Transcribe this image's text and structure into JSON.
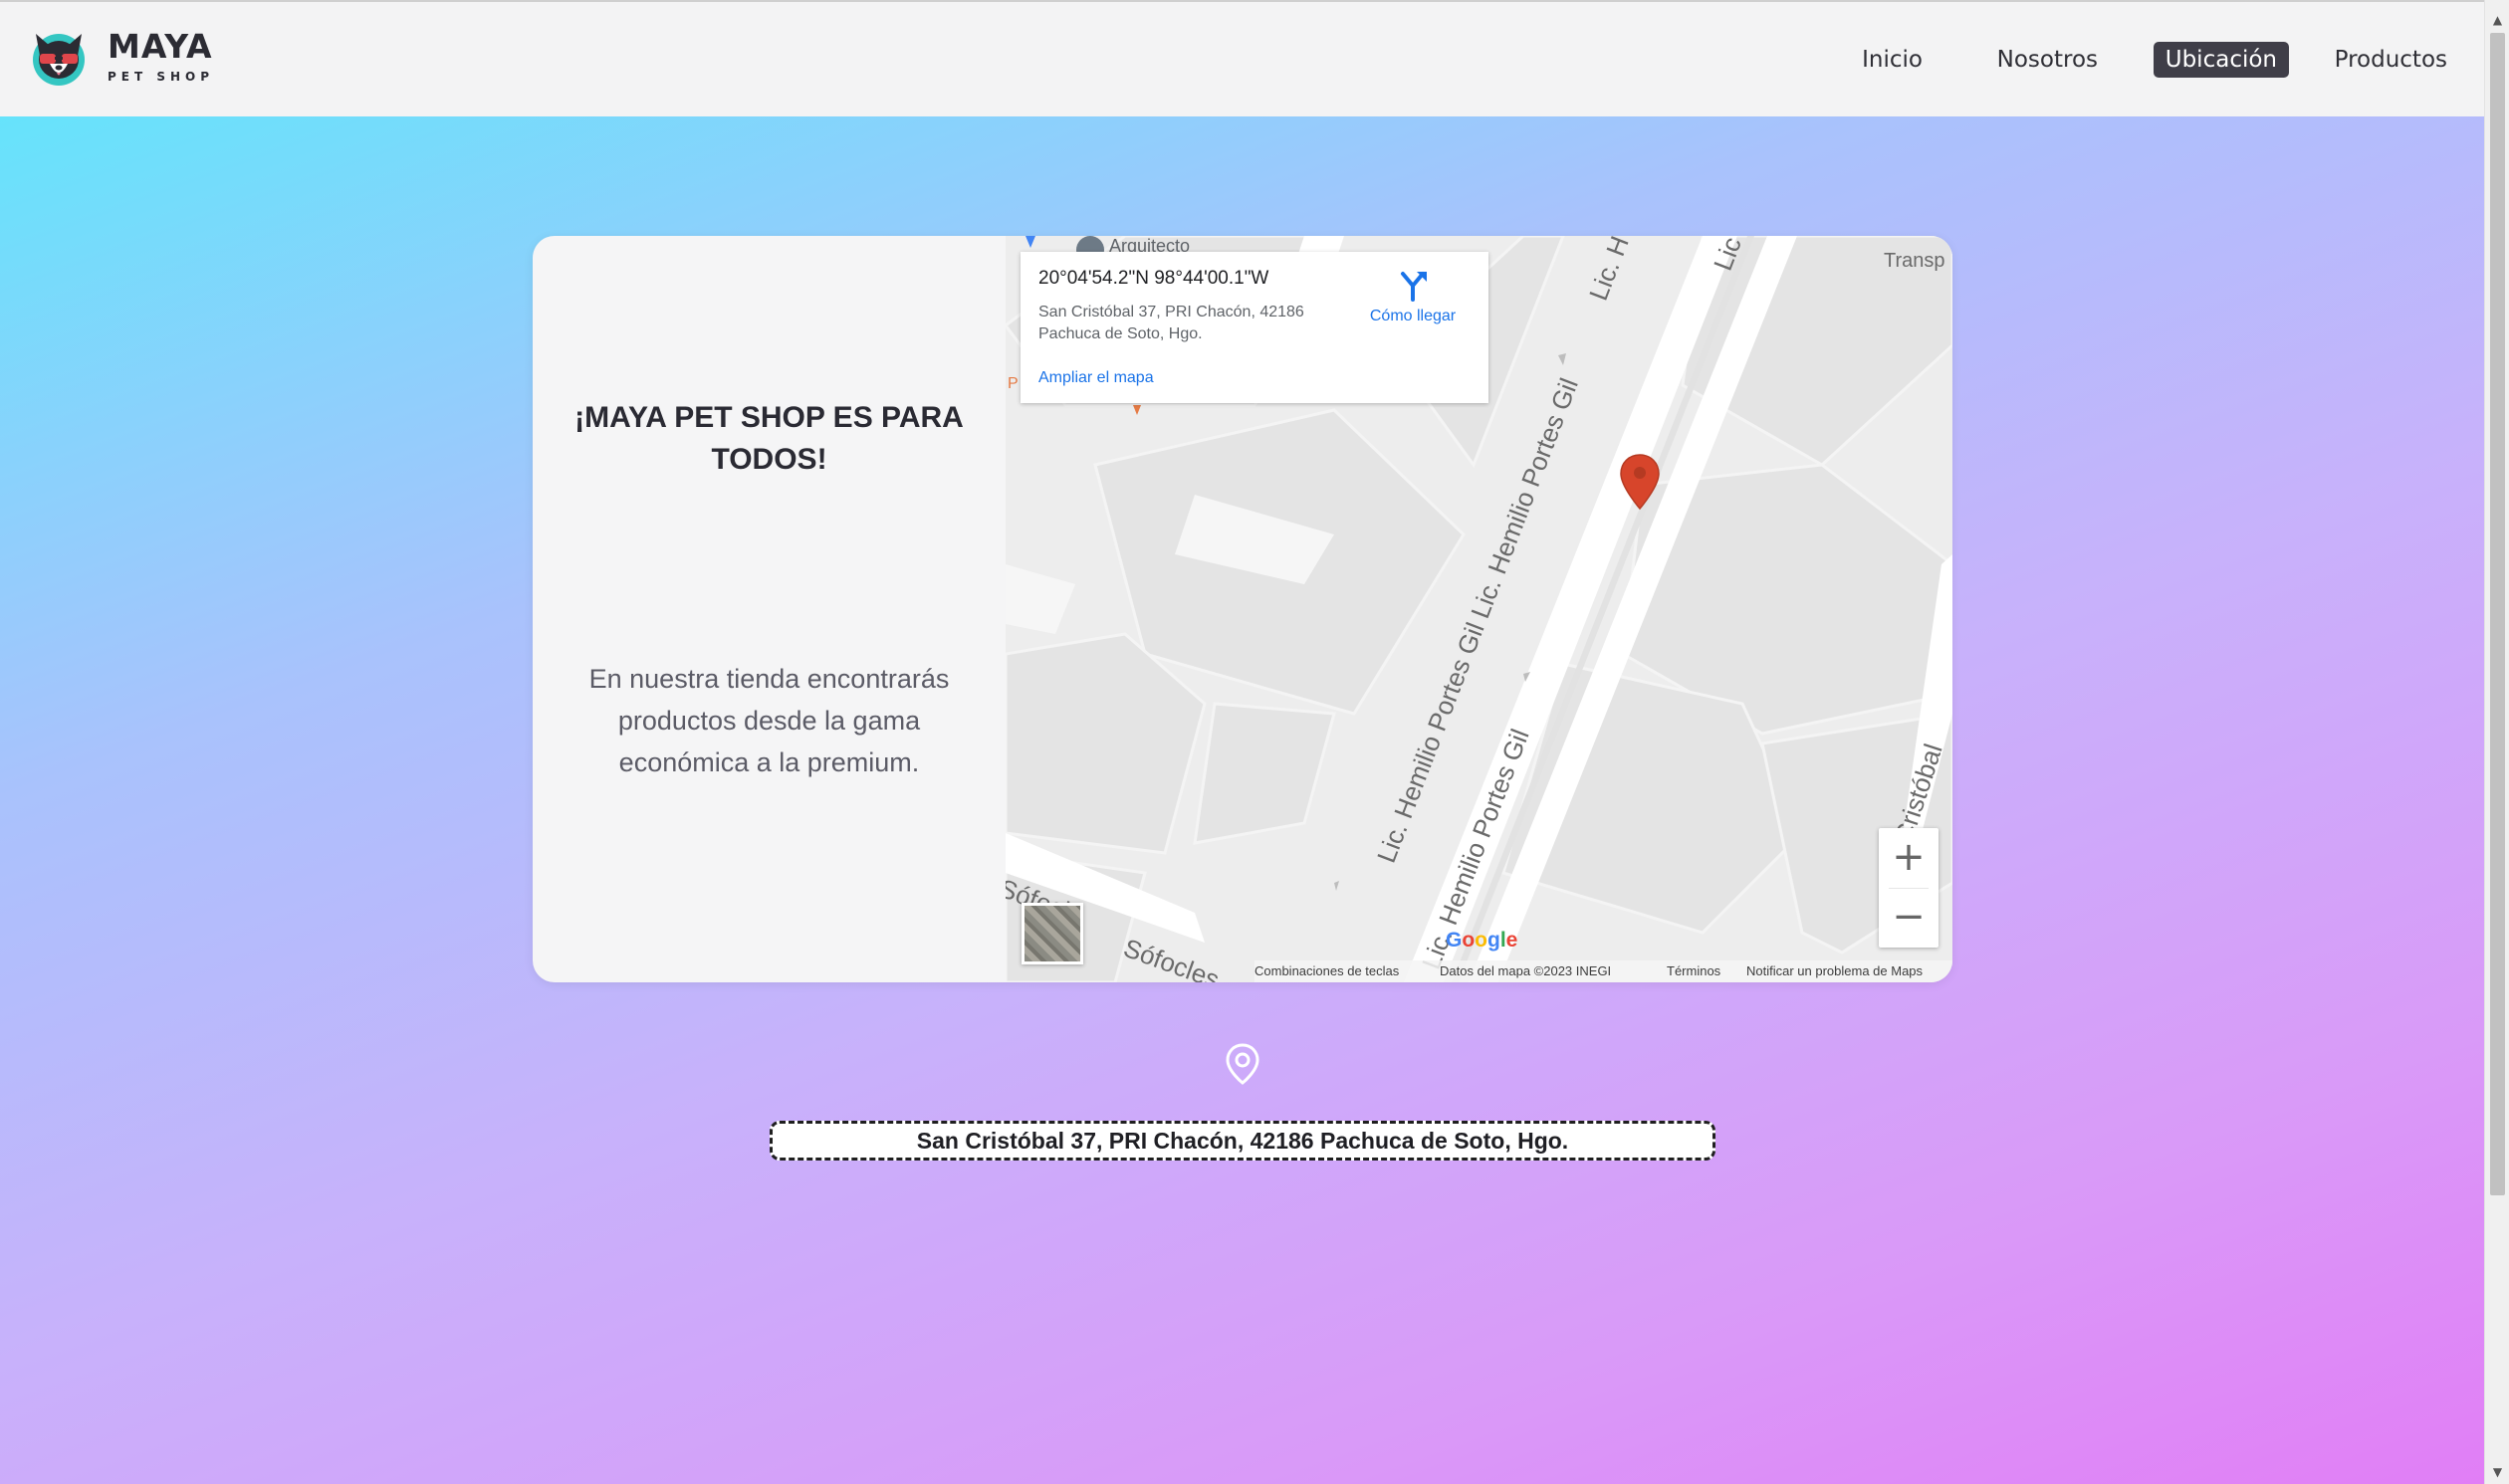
{
  "brand": {
    "name": "MAYA",
    "tagline": "PET SHOP",
    "logo_icon": "dog-with-sunglasses-logo-icon"
  },
  "nav": {
    "items": [
      {
        "label": "Inicio",
        "active": false
      },
      {
        "label": "Nosotros",
        "active": false
      },
      {
        "label": "Ubicación",
        "active": true
      },
      {
        "label": "Productos",
        "active": false
      }
    ]
  },
  "card": {
    "title": "¡MAYA PET SHOP ES PARA TODOS!",
    "description": "En nuestra tienda encontrarás productos desde la gama económica a la premium."
  },
  "map": {
    "info": {
      "coords": "20°04'54.2\"N 98°44'00.1\"W",
      "address": "San Cristóbal 37, PRI Chacón, 42186 Pachuca de Soto, Hgo.",
      "directions_label": "Cómo llegar",
      "enlarge_label": "Ampliar el mapa"
    },
    "streets": {
      "s1": "Lic. Hemilio Portes Gil Lic. Hemilio Portes Gil",
      "s2": "Lic. Hemilio Portes Gil",
      "s3": "Lic. H",
      "s4": "Lic",
      "s5": "Sófocles",
      "s6": "Sófocl",
      "s7": "San Cristóbal",
      "poi_arquitecto": "Arquitecto",
      "poi_transp": "Transp",
      "poi_p": "P"
    },
    "zoom_in": "+",
    "zoom_out": "−",
    "google": "Google",
    "attribution": {
      "shortcuts": "Combinaciones de teclas",
      "data": "Datos del mapa ©2023 INEGI",
      "terms": "Términos",
      "report": "Notificar un problema de Maps"
    },
    "colors": {
      "pin": "#d7452b",
      "link": "#1a73e8"
    }
  },
  "location": {
    "icon": "location-pin-icon",
    "address": "San Cristóbal 37, PRI Chacón, 42186 Pachuca de Soto, Hgo."
  },
  "scrollbar": {
    "up": "▲",
    "down": "▼"
  }
}
